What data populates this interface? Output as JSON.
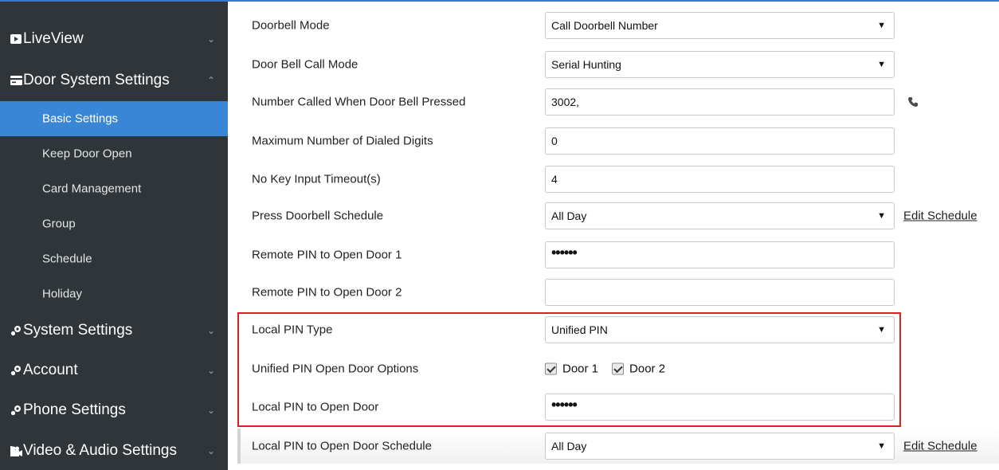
{
  "sidebar": {
    "items": [
      {
        "label": "LiveView",
        "icon": "video-icon",
        "expanded": false
      },
      {
        "label": "Door System Settings",
        "icon": "card-icon",
        "expanded": true
      },
      {
        "label": "System Settings",
        "icon": "settings-icon",
        "expanded": false
      },
      {
        "label": "Account",
        "icon": "settings-icon",
        "expanded": false
      },
      {
        "label": "Phone Settings",
        "icon": "settings-icon",
        "expanded": false
      },
      {
        "label": "Video & Audio Settings",
        "icon": "camera-icon",
        "expanded": false
      }
    ],
    "subitems": [
      {
        "label": "Basic Settings",
        "active": true
      },
      {
        "label": "Keep Door Open",
        "active": false
      },
      {
        "label": "Card Management",
        "active": false
      },
      {
        "label": "Group",
        "active": false
      },
      {
        "label": "Schedule",
        "active": false
      },
      {
        "label": "Holiday",
        "active": false
      }
    ]
  },
  "form": {
    "doorbell_mode": {
      "label": "Doorbell Mode",
      "value": "Call Doorbell Number"
    },
    "door_bell_call_mode": {
      "label": "Door Bell Call Mode",
      "value": "Serial Hunting"
    },
    "number_called": {
      "label": "Number Called When Door Bell Pressed",
      "value": "3002,"
    },
    "max_digits": {
      "label": "Maximum Number of Dialed Digits",
      "value": "0"
    },
    "no_key_timeout": {
      "label": "No Key Input Timeout(s)",
      "value": "4"
    },
    "press_doorbell_schedule": {
      "label": "Press Doorbell Schedule",
      "value": "All Day",
      "link": "Edit Schedule"
    },
    "remote_pin_door1": {
      "label": "Remote PIN to Open Door 1",
      "value": "••••••"
    },
    "remote_pin_door2": {
      "label": "Remote PIN to Open Door 2",
      "value": ""
    },
    "local_pin_type": {
      "label": "Local PIN Type",
      "value": "Unified PIN"
    },
    "unified_pin_options": {
      "label": "Unified PIN Open Door Options",
      "door1": "Door 1",
      "door2": "Door 2"
    },
    "local_pin_open_door": {
      "label": "Local PIN to Open Door",
      "value": "••••••"
    },
    "local_pin_schedule": {
      "label": "Local PIN to Open Door Schedule",
      "value": "All Day",
      "link": "Edit Schedule"
    }
  },
  "colors": {
    "sidebar_bg": "#2f3538",
    "active_bg": "#3a86d6",
    "highlight_border": "#e02020"
  }
}
